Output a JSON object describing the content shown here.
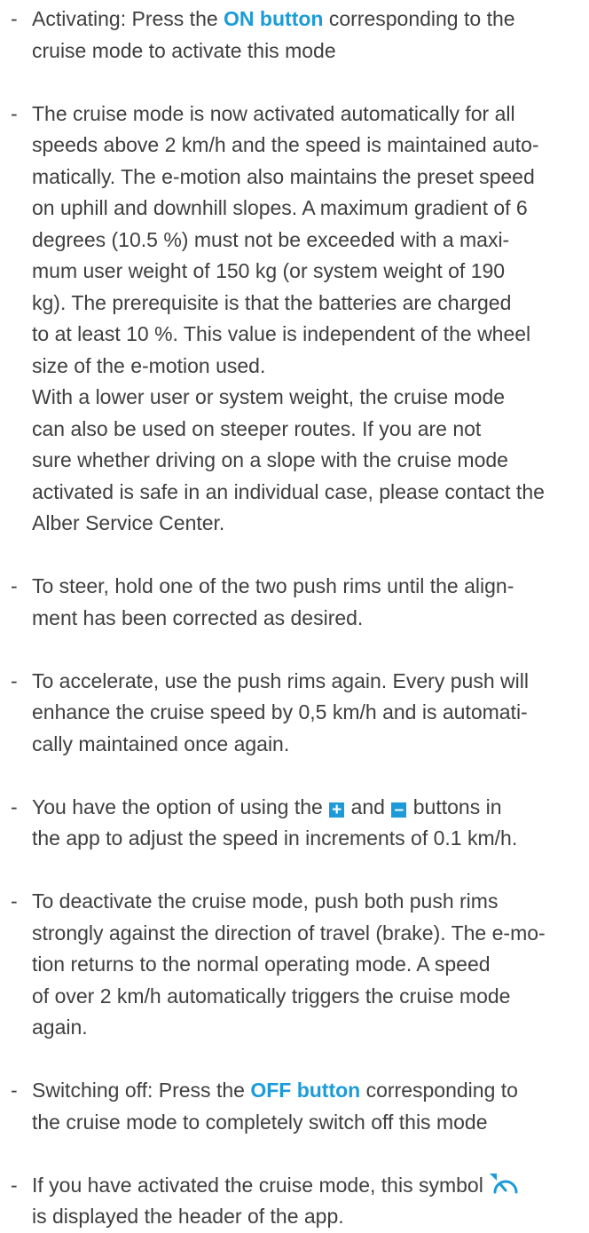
{
  "dash": "-",
  "items": [
    {
      "lines": [
        [
          "Activating: Press the ",
          {
            "hl": "ON button"
          },
          " corresponding to the"
        ],
        [
          "cruise mode to activate this mode"
        ]
      ]
    },
    {
      "lines": [
        [
          "The cruise mode is now activated automatically for all"
        ],
        [
          "speeds above 2 km/h and the speed is maintained auto-"
        ],
        [
          "matically. The e-motion also maintains the preset speed"
        ],
        [
          "on uphill and downhill slopes. A maximum gradient of 6"
        ],
        [
          "degrees (10.5 %) must not be exceeded with a maxi-"
        ],
        [
          "mum user weight of 150 kg (or system weight of 190"
        ],
        [
          "kg). The prerequisite is that the batteries are charged"
        ],
        [
          "to at least 10 %. This value is independent of the wheel"
        ],
        [
          "size of the e-motion used."
        ],
        [
          "With a lower user or system weight, the cruise mode"
        ],
        [
          "can also be used on steeper routes. If you are not"
        ],
        [
          "sure whether driving on a slope with the cruise mode"
        ],
        [
          "activated is safe in an individual case, please contact the"
        ],
        [
          "Alber Service Center."
        ]
      ]
    },
    {
      "lines": [
        [
          "To steer, hold one of the two push rims until the align-"
        ],
        [
          "ment has been corrected as desired."
        ]
      ]
    },
    {
      "lines": [
        [
          "To accelerate, use the push rims again. Every push will"
        ],
        [
          "enhance the cruise speed by 0,5 km/h and is automati-"
        ],
        [
          "cally maintained once again."
        ]
      ]
    },
    {
      "lines": [
        [
          "You have the option of using the ",
          {
            "btn": "+"
          },
          " and ",
          {
            "btn": "–"
          },
          " buttons in"
        ],
        [
          "the app to adjust the speed in increments of 0.1 km/h."
        ]
      ]
    },
    {
      "lines": [
        [
          "To deactivate the cruise mode, push both push rims"
        ],
        [
          "strongly against the direction of travel (brake). The e-mo-"
        ],
        [
          "tion returns to the normal operating mode. A speed"
        ],
        [
          "of over 2 km/h automatically triggers the cruise mode"
        ],
        [
          "again."
        ]
      ]
    },
    {
      "lines": [
        [
          "Switching off: Press the ",
          {
            "hl": "OFF button"
          },
          " corresponding to"
        ],
        [
          "the cruise mode to completely switch off this mode"
        ]
      ]
    },
    {
      "lines": [
        [
          "If you have activated the cruise mode, this symbol",
          {
            "icon": "cruise-mode-icon"
          }
        ],
        [
          "is displayed the header of the app."
        ]
      ]
    }
  ],
  "colors": {
    "text": "#3f3f3f",
    "accent": "#1c9bd8"
  }
}
